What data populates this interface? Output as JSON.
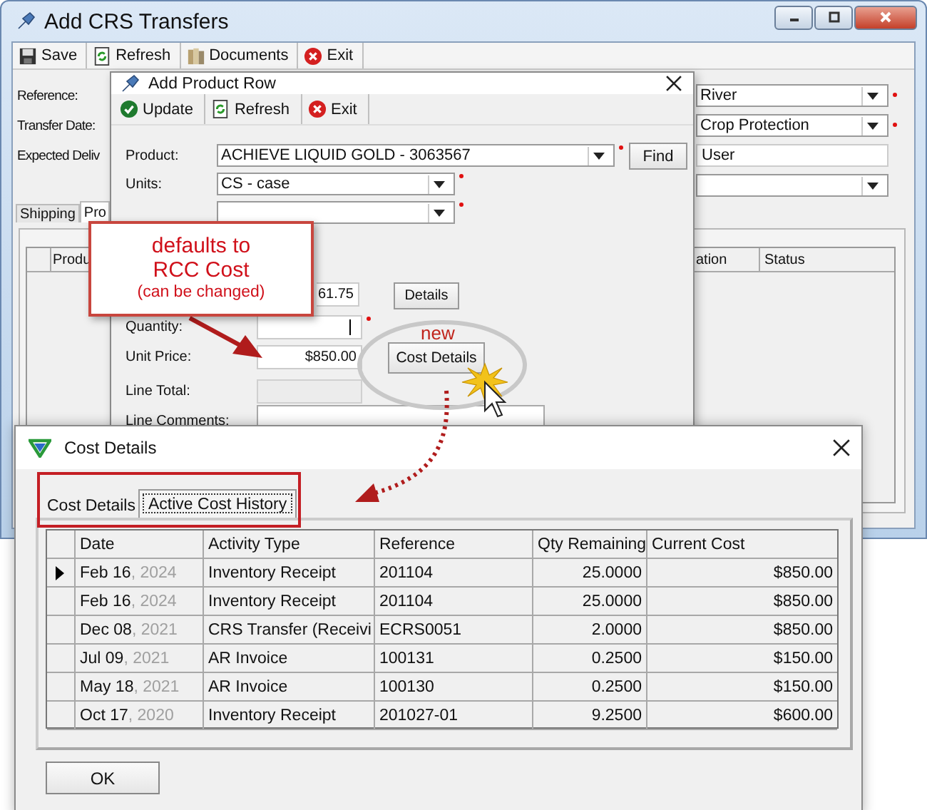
{
  "main_window": {
    "title": "Add CRS Transfers",
    "toolbar": [
      {
        "kind": "save",
        "label": "Save"
      },
      {
        "kind": "refresh",
        "label": "Refresh"
      },
      {
        "kind": "documents",
        "label": "Documents"
      },
      {
        "kind": "exit",
        "label": "Exit"
      }
    ],
    "labels": [
      "Reference:",
      "Transfer Date:",
      "Expected Deliv"
    ],
    "fields": [
      {
        "kind": "combo",
        "value": "River",
        "required": true
      },
      {
        "kind": "combo",
        "value": "Crop Protection",
        "required": true
      },
      {
        "kind": "text",
        "value": "User",
        "required": false
      },
      {
        "kind": "combo",
        "required": false
      }
    ],
    "tabs": [
      {
        "label": "Shipping",
        "selected": false
      },
      {
        "label": "Pro",
        "selected": true
      }
    ],
    "grid_columns": [
      "Produ",
      "ation",
      "Status"
    ]
  },
  "product_dialog": {
    "title": "Add Product Row",
    "toolbar": [
      {
        "kind": "update",
        "label": "Update"
      },
      {
        "kind": "refresh",
        "label": "Refresh"
      },
      {
        "kind": "exit",
        "label": "Exit"
      }
    ],
    "top_rows": [
      {
        "label": "Product:",
        "value": "ACHIEVE LIQUID GOLD - 3063567",
        "required": true,
        "button": "Find"
      },
      {
        "label": "Units:",
        "value": "CS - case",
        "required": true
      },
      {
        "required": true
      }
    ],
    "rows": [
      {
        "value": "61.75",
        "button": "Details",
        "focused": false,
        "disabled": false
      },
      {
        "label": "Quantity:",
        "required": true,
        "focused": true,
        "disabled": false
      },
      {
        "label": "Unit Price:",
        "value": "$850.00",
        "button": "Cost Details",
        "focused": false,
        "disabled": false
      },
      {
        "label": "Line Total:",
        "focused": false,
        "disabled": true
      }
    ],
    "comments_label": "Line Comments:"
  },
  "annotations": {
    "callout": [
      "defaults to",
      "RCC Cost",
      "(can be changed)"
    ],
    "new_label": "new"
  },
  "cost_dialog": {
    "title": "Cost Details",
    "tabs": [
      {
        "label": "Cost Details",
        "selected": false
      },
      {
        "label": "Active Cost History",
        "selected": true
      }
    ],
    "columns": [
      "Date",
      "Activity Type",
      "Reference",
      "Qty Remaining",
      "Current Cost"
    ],
    "rows": [
      {
        "date": "Feb 16",
        "year": ", 2024",
        "activity": "Inventory Receipt",
        "reference": "201104",
        "qty": "25.0000",
        "cost": "$850.00",
        "current": true
      },
      {
        "date": "Feb 16",
        "year": ", 2024",
        "activity": "Inventory Receipt",
        "reference": "201104",
        "qty": "25.0000",
        "cost": "$850.00",
        "current": false
      },
      {
        "date": "Dec 08",
        "year": ", 2021",
        "activity": "CRS Transfer (Receivi",
        "reference": "ECRS0051",
        "qty": "2.0000",
        "cost": "$850.00",
        "current": false
      },
      {
        "date": "Jul 09",
        "year": ", 2021",
        "activity": "AR Invoice",
        "reference": "100131",
        "qty": "0.2500",
        "cost": "$150.00",
        "current": false
      },
      {
        "date": "May 18",
        "year": ", 2021",
        "activity": "AR Invoice",
        "reference": "100130",
        "qty": "0.2500",
        "cost": "$150.00",
        "current": false
      },
      {
        "date": "Oct 17",
        "year": ", 2020",
        "activity": "Inventory Receipt",
        "reference": "201027-01",
        "qty": "9.2500",
        "cost": "$600.00",
        "current": false
      }
    ],
    "ok_button": "OK"
  }
}
